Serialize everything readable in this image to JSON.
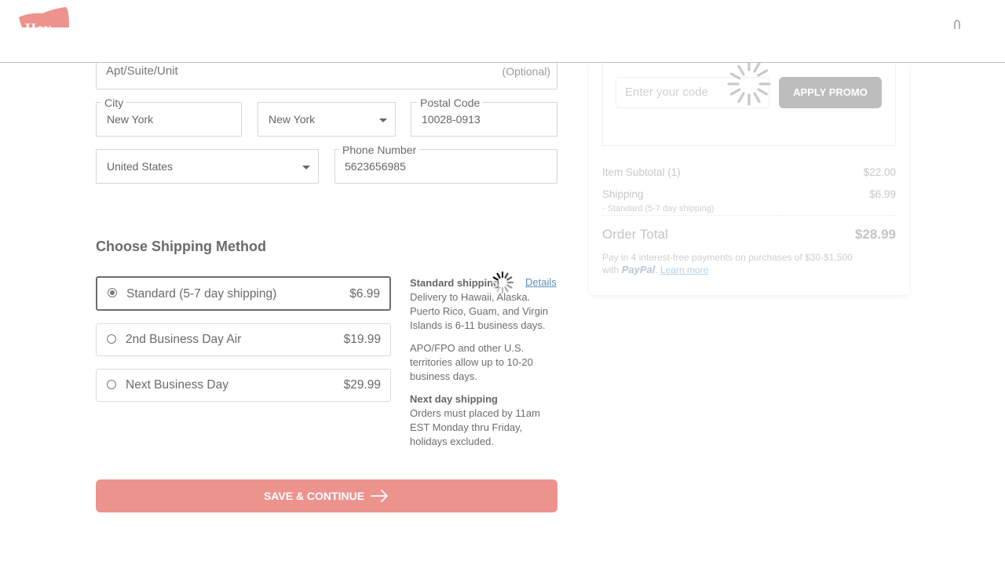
{
  "header": {
    "logo_text": "Hey",
    "colors": {
      "brand": "#ed938d"
    },
    "user_icon": "user-icon"
  },
  "address": {
    "apt_placeholder": "Apt/Suite/Unit",
    "apt_optional": "(Optional)",
    "city_label": "City",
    "city_value": "New York",
    "state_value": "New York",
    "postal_label": "Postal Code",
    "postal_value": "10028-0913",
    "country_value": "United States",
    "phone_label": "Phone Number",
    "phone_value": "5623656985"
  },
  "shipping": {
    "title": "Choose Shipping Method",
    "options": [
      {
        "name": "Standard (5-7 day shipping)",
        "price": "$6.99",
        "selected": true
      },
      {
        "name": "2nd Business Day Air",
        "price": "$19.99",
        "selected": false
      },
      {
        "name": "Next Business Day",
        "price": "$29.99",
        "selected": false
      }
    ],
    "details_link": "Details",
    "info": {
      "standard_title": "Standard shipping",
      "standard_text": "Delivery to Hawaii, Alaska. Puerto Rico, Guam, and Virgin Islands is 6-11 business days.",
      "apo_text": "APO/FPO and other U.S. territories allow up to 10-20 business days.",
      "next_title": "Next day shipping",
      "next_text": "Orders must placed by 11am EST Monday thru Friday, holidays excluded."
    }
  },
  "save_button": "SAVE & CONTINUE",
  "summary": {
    "promo_placeholder": "Enter your code",
    "promo_button": "APPLY PROMO",
    "subtotal_label": "Item Subtotal (1)",
    "subtotal_value": "$22.00",
    "shipping_label": "Shipping",
    "shipping_value": "$6.99",
    "shipping_method": "- Standard (5-7 day shipping)",
    "total_label": "Order Total",
    "total_value": "$28.99",
    "paypal_line1": "Pay in 4 interest-free payments on purchases of $30-$1,500",
    "paypal_with": "with",
    "paypal_brand": "PayPal",
    "learn_more": "Learn more"
  }
}
